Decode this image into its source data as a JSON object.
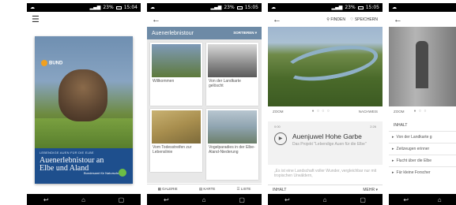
{
  "status": {
    "p1": {
      "time": "15:04",
      "battery": "23%"
    },
    "p2": {
      "time": "15:05",
      "battery": "23%"
    },
    "p3": {
      "time": "15:05",
      "battery": "23%"
    }
  },
  "navbar": {
    "back": "↩",
    "home": "⌂",
    "recent": "▢"
  },
  "screen1": {
    "menu_icon": "☰",
    "cover": {
      "logo": "BUND",
      "subtitle": "LEBENDIGE AUEN FÜR DIE ELBE",
      "title": "Auenerlebnistour an Elbe und Aland",
      "brand": "Bundesamt für Naturschutz"
    }
  },
  "screen2": {
    "back_icon": "←",
    "header": "Auenerlebnistour",
    "sort_label": "SORTIEREN ▾",
    "tiles": [
      {
        "caption": "Willkommen"
      },
      {
        "caption": "Von der Landkarte gelöscht"
      },
      {
        "caption": "Vom Todesstreifen zur Lebenslinie"
      },
      {
        "caption": "Vogelparadies in der Elbe-Aland-Niederung"
      }
    ],
    "bottom": {
      "galerie": "GALERIE",
      "karte": "KARTE",
      "liste": "LISTE"
    }
  },
  "screen3": {
    "back_icon": "←",
    "finden": "FINDEN",
    "speichern": "SPEICHERN",
    "zoom": "ZOOM",
    "nachweis": "NACHWEIS",
    "time_start": "0:00",
    "time_end": "2:26",
    "title": "Auenjuwel Hohe Garbe",
    "desc": "Das Projekt \"Lebendige Auen für die Elbe\"",
    "quote": "„Es ist eine Landschaft voller Wunder, vergleichbar nur mit tropischen Urwäldern,",
    "inhalt": "INHALT",
    "mehr": "MEHR ▾"
  },
  "screen4": {
    "back_icon": "←",
    "zoom": "ZOOM",
    "inhalt": "INHALT",
    "items": [
      "Von der Landkarte g",
      "Zeitzeugen erinner",
      "Flucht über die Elbe",
      "Für kleine Forscher"
    ]
  }
}
